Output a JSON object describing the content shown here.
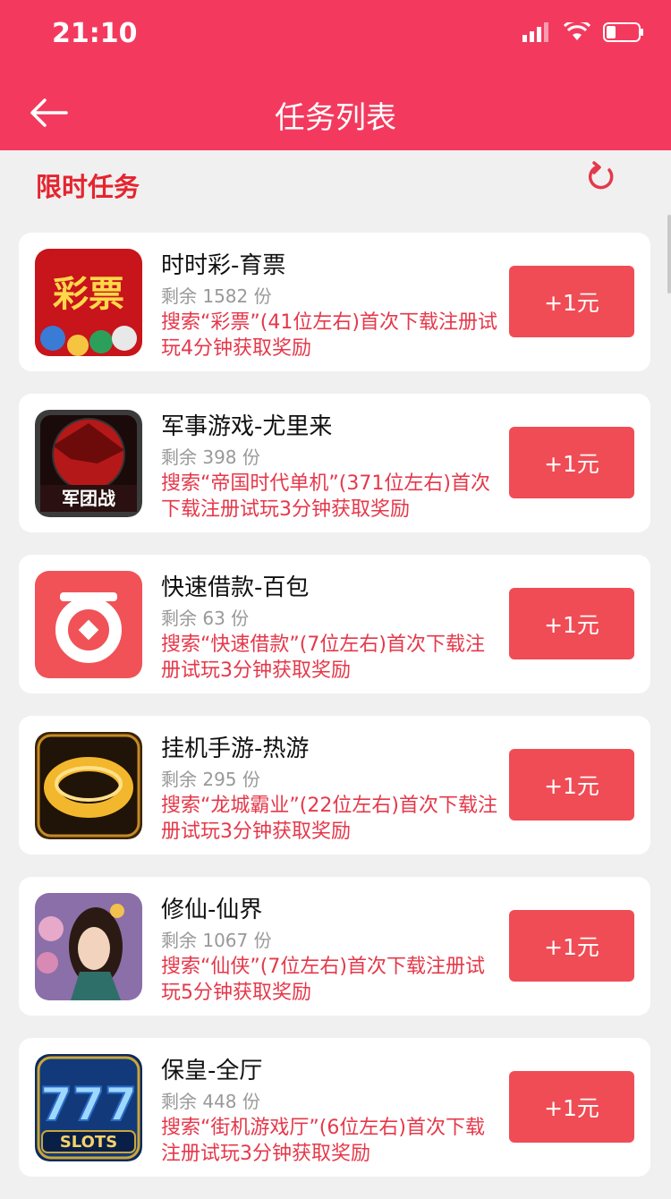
{
  "status_bar": {
    "time": "21:10"
  },
  "nav": {
    "title": "任务列表"
  },
  "section": {
    "title": "限时任务"
  },
  "tasks": [
    {
      "title": "时时彩-育票",
      "remaining": "剩余 1582 份",
      "desc": "搜索“彩票”(41位左右)首次下载注册试玩4分钟获取奖励",
      "button": "+1元",
      "icon_text": "彩票"
    },
    {
      "title": "军事游戏-尤里来",
      "remaining": "剩余 398 份",
      "desc": "搜索“帝国时代单机”(371位左右)首次下载注册试玩3分钟获取奖励",
      "button": "+1元",
      "icon_text": "军团战"
    },
    {
      "title": "快速借款-百包",
      "remaining": "剩余 63 份",
      "desc": "搜索“快速借款”(7位左右)首次下载注册试玩3分钟获取奖励",
      "button": "+1元"
    },
    {
      "title": "挂机手游-热游",
      "remaining": "剩余 295 份",
      "desc": "搜索“龙城霸业”(22位左右)首次下载注册试玩3分钟获取奖励",
      "button": "+1元"
    },
    {
      "title": "修仙-仙界",
      "remaining": "剩余 1067 份",
      "desc": "搜索“仙侠”(7位左右)首次下载注册试玩5分钟获取奖励",
      "button": "+1元"
    },
    {
      "title": "保皇-全厅",
      "remaining": "剩余 448 份",
      "desc": "搜索“街机游戏厅”(6位左右)首次下载注册试玩3分钟获取奖励",
      "button": "+1元",
      "icon_text": "SLOTS"
    }
  ],
  "colors": {
    "brand": "#f33a5e",
    "accent_red": "#e5252f",
    "button": "#f04c55"
  }
}
